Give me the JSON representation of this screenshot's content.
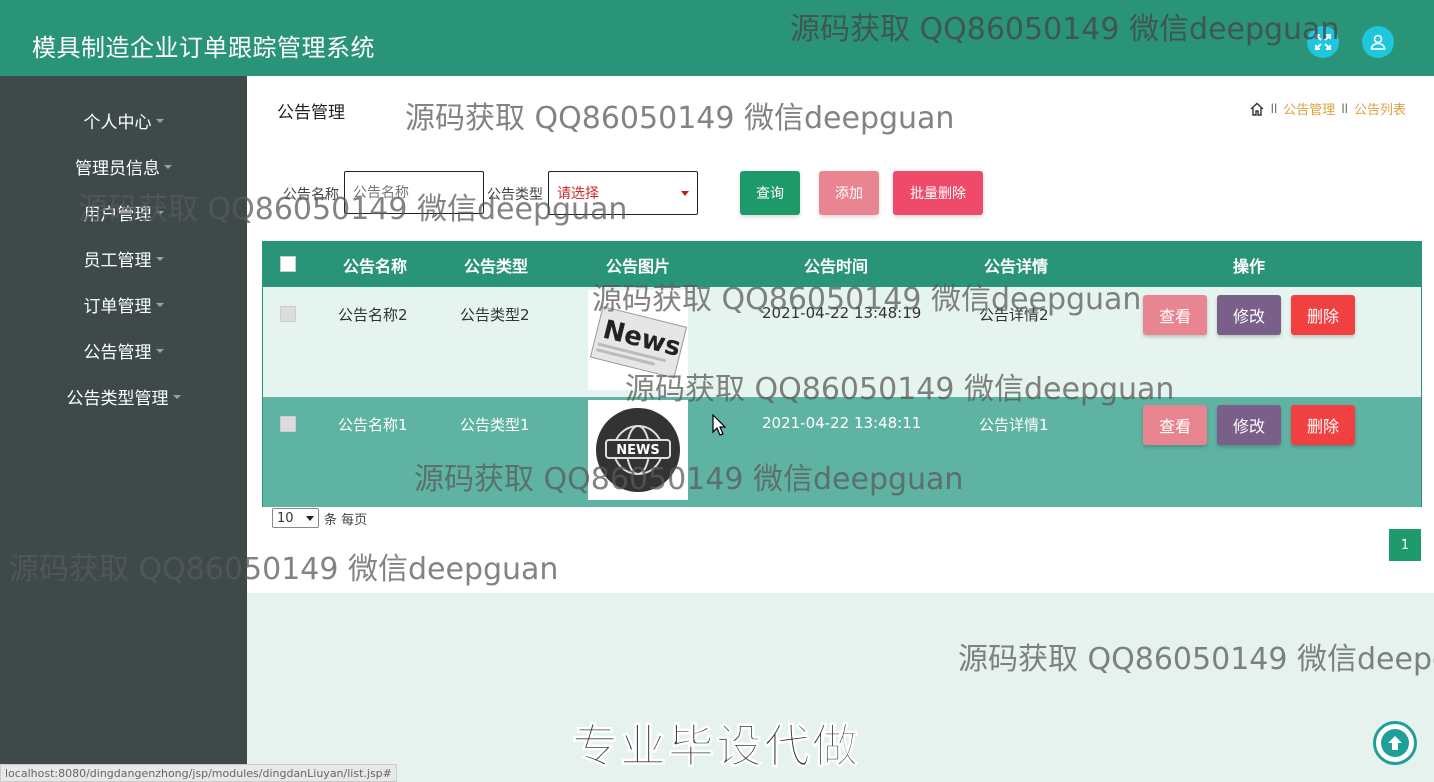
{
  "header": {
    "title": "模具制造企业订单跟踪管理系统",
    "fullscreen_icon": "expand-icon",
    "user_icon": "user-icon"
  },
  "sidebar": {
    "items": [
      {
        "label": "个人中心"
      },
      {
        "label": "管理员信息"
      },
      {
        "label": "用户管理"
      },
      {
        "label": "员工管理"
      },
      {
        "label": "订单管理"
      },
      {
        "label": "公告管理"
      },
      {
        "label": "公告类型管理"
      }
    ]
  },
  "page": {
    "title": "公告管理",
    "breadcrumb": [
      "公告管理",
      "公告列表"
    ]
  },
  "filters": {
    "name_label": "公告名称",
    "name_placeholder": "公告名称",
    "type_label": "公告类型",
    "type_selected": "请选择",
    "search_label": "查询",
    "add_label": "添加",
    "batch_delete_label": "批量删除"
  },
  "table": {
    "columns": [
      "公告名称",
      "公告类型",
      "公告图片",
      "公告时间",
      "公告详情",
      "操作"
    ],
    "rows": [
      {
        "name": "公告名称2",
        "type": "公告类型2",
        "image": "news-newspaper-image",
        "time": "2021-04-22 13:48:19",
        "detail": "公告详情2"
      },
      {
        "name": "公告名称1",
        "type": "公告类型1",
        "image": "news-globe-image",
        "time": "2021-04-22 13:48:11",
        "detail": "公告详情1"
      }
    ],
    "actions": {
      "view": "查看",
      "edit": "修改",
      "delete": "删除"
    }
  },
  "pagination": {
    "page_size": "10",
    "per_page_text": "条 每页",
    "current_page": "1"
  },
  "watermarks": {
    "text": "源码获取 QQ86050149 微信deepguan",
    "text_cut": "源码获取 QQ86050149 微信deepg",
    "big": "专业毕设代做"
  },
  "status_bar": {
    "url": "localhost:8080/dingdangenzhong/jsp/modules/dingdanLiuyan/list.jsp#"
  },
  "colors": {
    "header": "#2a9479",
    "sidebar": "#3e4a4a",
    "row_light": "#e6f4ef",
    "row_dark": "#5fb3a3",
    "search_btn": "#1e9a6a",
    "add_btn": "#e88590",
    "batch_delete_btn": "#f04a6a",
    "view_btn": "#e88590",
    "edit_btn": "#7a5f8a",
    "delete_btn": "#f04040"
  }
}
